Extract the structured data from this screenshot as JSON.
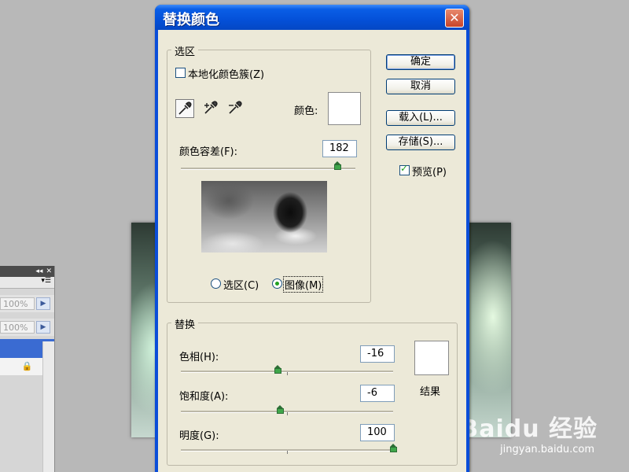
{
  "dialog": {
    "title": "替换颜色",
    "close_glyph": "✕",
    "selection_group": {
      "legend": "选区",
      "localized_clusters": {
        "label": "本地化颜色簇(Z)",
        "checked": false
      },
      "color_label": "颜色:",
      "color_value": "#ffffff",
      "fuzziness_label": "颜色容差(F):",
      "fuzziness_value": "182",
      "fuzziness_fraction": 0.9,
      "radio_selection": {
        "label": "选区(C)",
        "checked": false
      },
      "radio_image": {
        "label": "图像(M)",
        "checked": true
      }
    },
    "replacement_group": {
      "legend": "替换",
      "hue_label": "色相(H):",
      "hue_value": "-16",
      "hue_fraction": 0.456,
      "saturation_label": "饱和度(A):",
      "saturation_value": "-6",
      "saturation_fraction": 0.47,
      "lightness_label": "明度(G):",
      "lightness_value": "100",
      "lightness_fraction": 1.0,
      "result_label": "结果",
      "result_color": "#ffffff"
    },
    "buttons": {
      "ok": "确定",
      "cancel": "取消",
      "load": "载入(L)...",
      "save": "存储(S)..."
    },
    "preview_checkbox": {
      "label": "预览(P)",
      "checked": true
    }
  },
  "side_panel": {
    "opacity_1": "100%",
    "opacity_2": "100%",
    "lock_glyph": "🔒"
  },
  "watermark": {
    "brand": "Baidu 经验",
    "url": "jingyan.baidu.com"
  },
  "icons": [
    "close-icon",
    "eyedropper-icon",
    "eyedropper-plus-icon",
    "eyedropper-minus-icon",
    "lock-icon",
    "panel-menu-icon"
  ]
}
